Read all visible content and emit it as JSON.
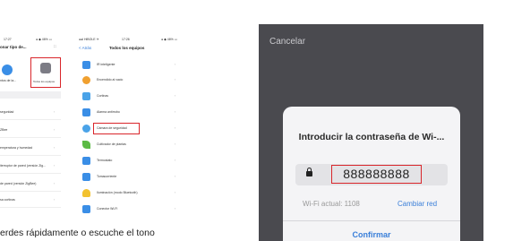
{
  "phone1": {
    "header": {
      "time": "17:27",
      "status": "● ◆ 46% ▭",
      "title": "onar tipo de...",
      "corner": "⛶"
    },
    "tiles": [
      {
        "label": "..."
      },
      {
        "label": "Todos los equipos"
      }
    ],
    "tile_left_label": "ntos de la...",
    "rows": [
      "seguridad",
      "ZBee",
      "emperatura y humedad",
      "iterruptor de pared (versión Zig...",
      "de pared (versión ZigBee)",
      "sa cortinas",
      ""
    ]
  },
  "phone2": {
    "header": {
      "carrier": "●●l HiBOLE ✈",
      "time": "17:26",
      "status": "● ◆ 46% ▭",
      "back": "< Atrás",
      "title": "Todos los equipos"
    },
    "rows": [
      {
        "label": "IR inteligente",
        "color": "#3a8ee6"
      },
      {
        "label": "Encendido al vacio",
        "color": "#f0a030"
      },
      {
        "label": "Cortinas",
        "color": "#4aa3e8"
      },
      {
        "label": "Alarma antirrobo",
        "color": "#3a8ee6"
      },
      {
        "label": "Cámara de seguridad",
        "color": "#4aa3e8",
        "highlight": true
      },
      {
        "label": "Cultivador de plantas",
        "color": "#5cba45"
      },
      {
        "label": "Termostato",
        "color": "#3a8ee6"
      },
      {
        "label": "Tomacorriente",
        "color": "#3a8ee6"
      },
      {
        "label": "Iluminación (modo Bluetooth)",
        "color": "#f2c230"
      },
      {
        "label": "Conector Wi-Fi",
        "color": "#3a8ee6"
      }
    ]
  },
  "caption": "erdes rápidamente o escuche el tono",
  "dialog_screen": {
    "cancel": "Cancelar",
    "title": "Introducir la contraseña de Wi-...",
    "password": "888888888",
    "wifi_label": "Wi-Fi actual: 1108",
    "change": "Cambiar red",
    "confirm": "Confirmar"
  },
  "colors": {
    "highlight": "#d9262b",
    "link": "#3a7fd9",
    "overlay": "#4a4a4f"
  }
}
